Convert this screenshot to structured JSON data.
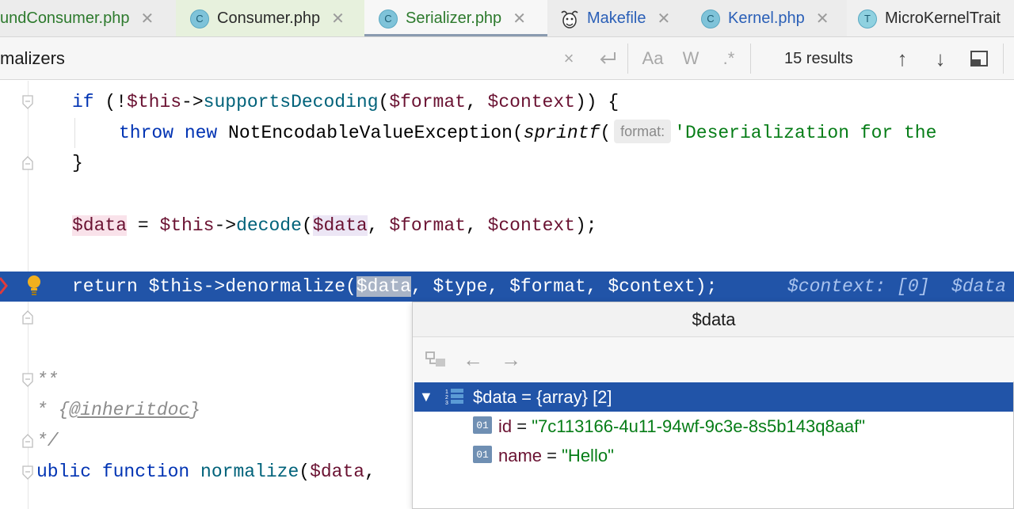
{
  "tabs": [
    {
      "label": "undConsumer.php",
      "icon": "close-icon"
    },
    {
      "label": "Consumer.php",
      "badge": "C"
    },
    {
      "label": "Serializer.php",
      "badge": "C"
    },
    {
      "label": "Makefile"
    },
    {
      "label": "Kernel.php",
      "badge": "C"
    },
    {
      "label": "MicroKernelTrait",
      "badge": "T"
    }
  ],
  "search": {
    "query": "malizers",
    "clear_symbol": "×",
    "match_case": "Aa",
    "whole_word": "W",
    "regex": ".*",
    "results": "15 results",
    "prev_symbol": "↑",
    "next_symbol": "↓"
  },
  "code": {
    "l1_if": "if",
    "l1_rest_a": " (!",
    "l1_this": "$this",
    "l1_arrow": "->",
    "l1_fn": "supportsDecoding",
    "l1_open": "(",
    "l1_format": "$format",
    "l1_comma": ", ",
    "l1_context": "$context",
    "l1_close": ")) {",
    "l2_throw": "throw",
    "l2_new": " new",
    "l2_cls": " NotEncodableValueException(",
    "l2_sprintf": "sprintf",
    "l2_paren": "(",
    "l2_hint": "format:",
    "l2_str": "'Deserialization for the",
    "l3_brace": "}",
    "l4_data": "$data",
    "l4_eq": " = ",
    "l4_this": "$this",
    "l4_arrow": "->",
    "l4_fn": "decode",
    "l4_open": "(",
    "l4_arg": "$data",
    "l4_comma1": ", ",
    "l4_format": "$format",
    "l4_comma2": ", ",
    "l4_context": "$context",
    "l4_close": ");",
    "l5_return": "return $this->denormalize(",
    "l5_sel": "$data",
    "l5_rest": ", $type, $format, $context);",
    "l5_inline": "$context: [0]  $data",
    "l6_doc_start": "**",
    "l7_star": "* ",
    "l7_tag_open": "{",
    "l7_tag": "@inheritdoc",
    "l7_tag_close": "}",
    "l8_doc_end": "*/",
    "l9_kw": "ublic function",
    "l9_fn": " normalize",
    "l9_open": "(",
    "l9_arg": "$data",
    "l9_comma": ","
  },
  "popup": {
    "title": "$data",
    "back_symbol": "←",
    "forward_symbol": "→",
    "root": {
      "triangle": "▼",
      "name": "$data",
      "eq": " = ",
      "value": "{array} [2]"
    },
    "children": [
      {
        "icon_label": "01",
        "name": "id",
        "eq": " = ",
        "value": "\"7c113166-4u11-94wf-9c3e-8s5b143q8aaf\""
      },
      {
        "icon_label": "01",
        "name": "name",
        "eq": " = ",
        "value": "\"Hello\""
      }
    ]
  },
  "colors": {
    "accent": "#2154a8",
    "keyword": "#0033b3",
    "variable": "#6a1232",
    "string": "#067d17",
    "function": "#00627a"
  }
}
